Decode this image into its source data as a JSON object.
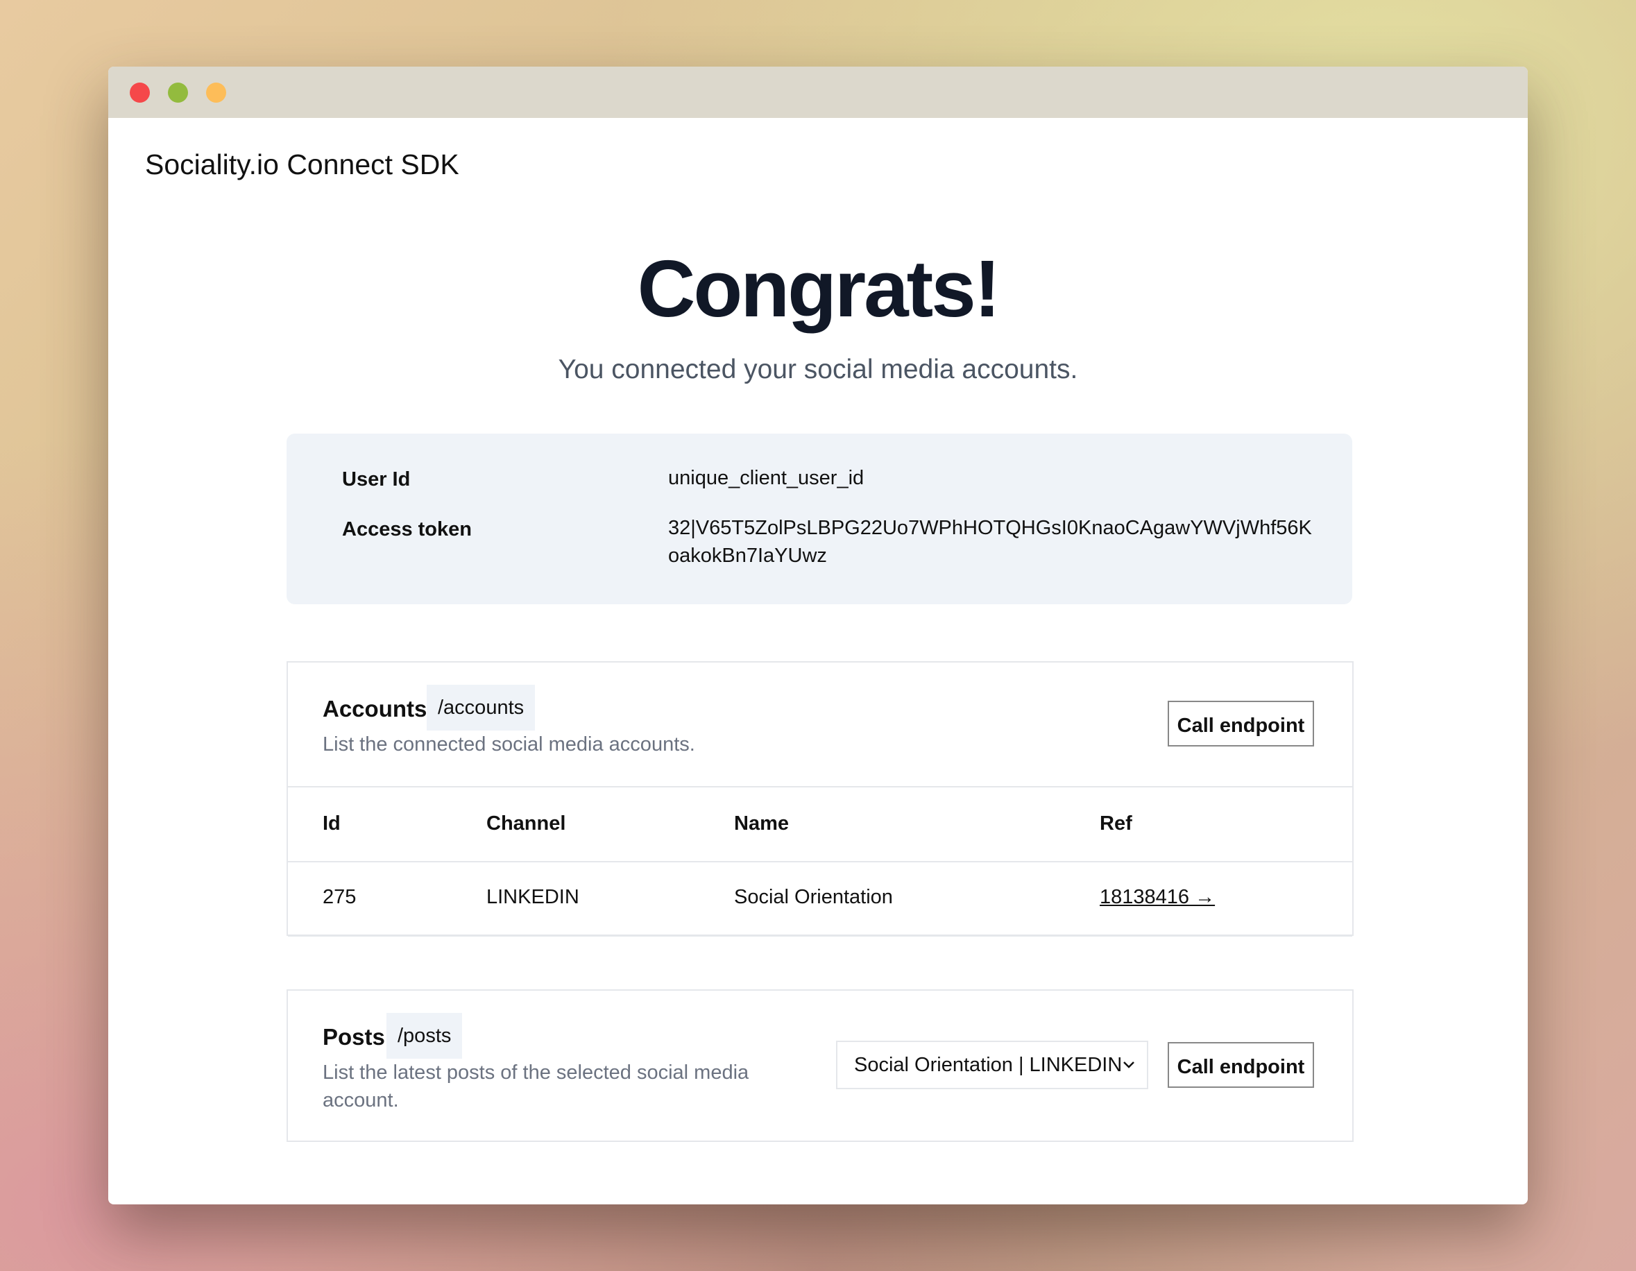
{
  "app": {
    "title": "Sociality.io Connect SDK"
  },
  "hero": {
    "headline": "Congrats!",
    "subheadline": "You connected your social media accounts."
  },
  "info": {
    "user_id_label": "User Id",
    "user_id_value": "unique_client_user_id",
    "token_label": "Access token",
    "token_value": "32|V65T5ZolPsLBPG22Uo7WPhHOTQHGsI0KnaoCAgawYWVjWhf56KoakokBn7IaYUwz"
  },
  "accounts": {
    "title": "Accounts",
    "endpoint": "/accounts",
    "description": "List the connected social media accounts.",
    "button_label": "Call endpoint",
    "columns": [
      "Id",
      "Channel",
      "Name",
      "Ref"
    ],
    "rows": [
      {
        "id": "275",
        "channel": "LINKEDIN",
        "name": "Social Orientation",
        "ref": "18138416 →"
      }
    ]
  },
  "posts": {
    "title": "Posts",
    "endpoint": "/posts",
    "description": "List the latest posts of the selected social media account.",
    "select_value": "Social Orientation | LINKEDIN",
    "button_label": "Call endpoint"
  },
  "colors": {
    "close": "#f5484a",
    "maximize": "#93bb3e",
    "minimize": "#fdbd59",
    "info_bg": "#eff3f8",
    "headline": "#111827"
  },
  "icons": {
    "select_caret": "chevron-down-icon"
  }
}
